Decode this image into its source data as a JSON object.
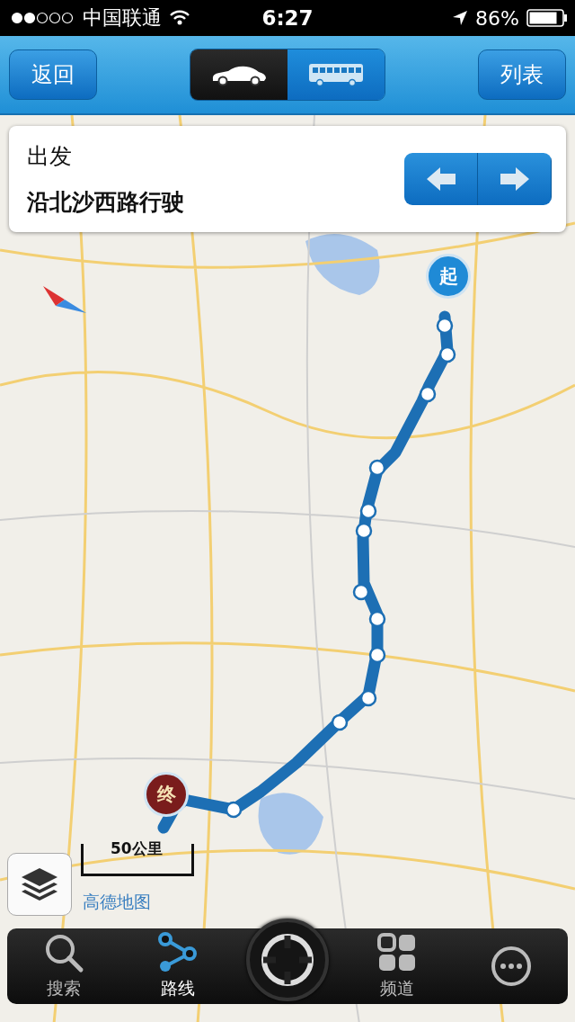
{
  "status_bar": {
    "carrier": "中国联通",
    "time": "6:27",
    "battery": "86%"
  },
  "nav_bar": {
    "back": "返回",
    "list": "列表",
    "modes": [
      {
        "kind": "car",
        "selected": true
      },
      {
        "kind": "bus",
        "selected": false
      }
    ]
  },
  "direction": {
    "title": "出发",
    "instruction": "沿北沙西路行驶"
  },
  "map": {
    "start_marker": "起",
    "end_marker": "终",
    "scale": "50公里",
    "logo": "高德地图"
  },
  "tab_bar": [
    {
      "kind": "search",
      "label": "搜索",
      "selected": false
    },
    {
      "kind": "route",
      "label": "路线",
      "selected": true
    },
    {
      "kind": "locate",
      "selected": false
    },
    {
      "kind": "channels",
      "label": "频道",
      "selected": false
    },
    {
      "kind": "more",
      "selected": false
    }
  ]
}
